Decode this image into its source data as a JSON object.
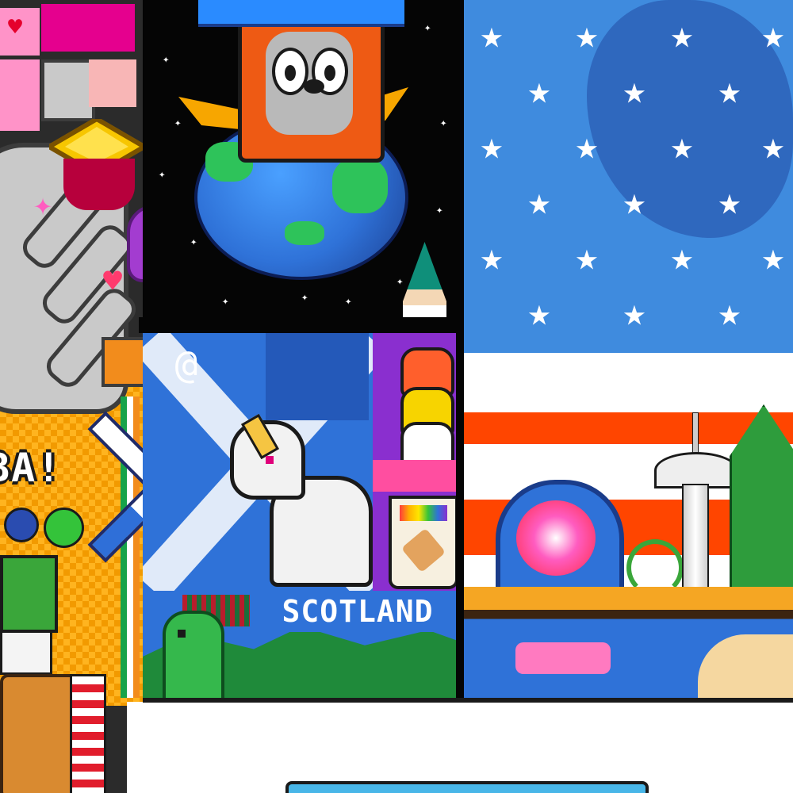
{
  "canvas": {
    "labels": {
      "scotland": "SCOTLAND",
      "ba": "BA!"
    },
    "colors": {
      "flag_blue": "#3f8bde",
      "flag_red": "#ff4500",
      "space_black": "#050505",
      "saltire_blue": "#2f72d8",
      "fox_orange": "#ee5a14",
      "yellow_checker": "#ffb41f"
    },
    "icons": [
      "heart-icon",
      "star-icon",
      "pink-heart-icon",
      "swirl-icon",
      "gem-icon"
    ]
  }
}
